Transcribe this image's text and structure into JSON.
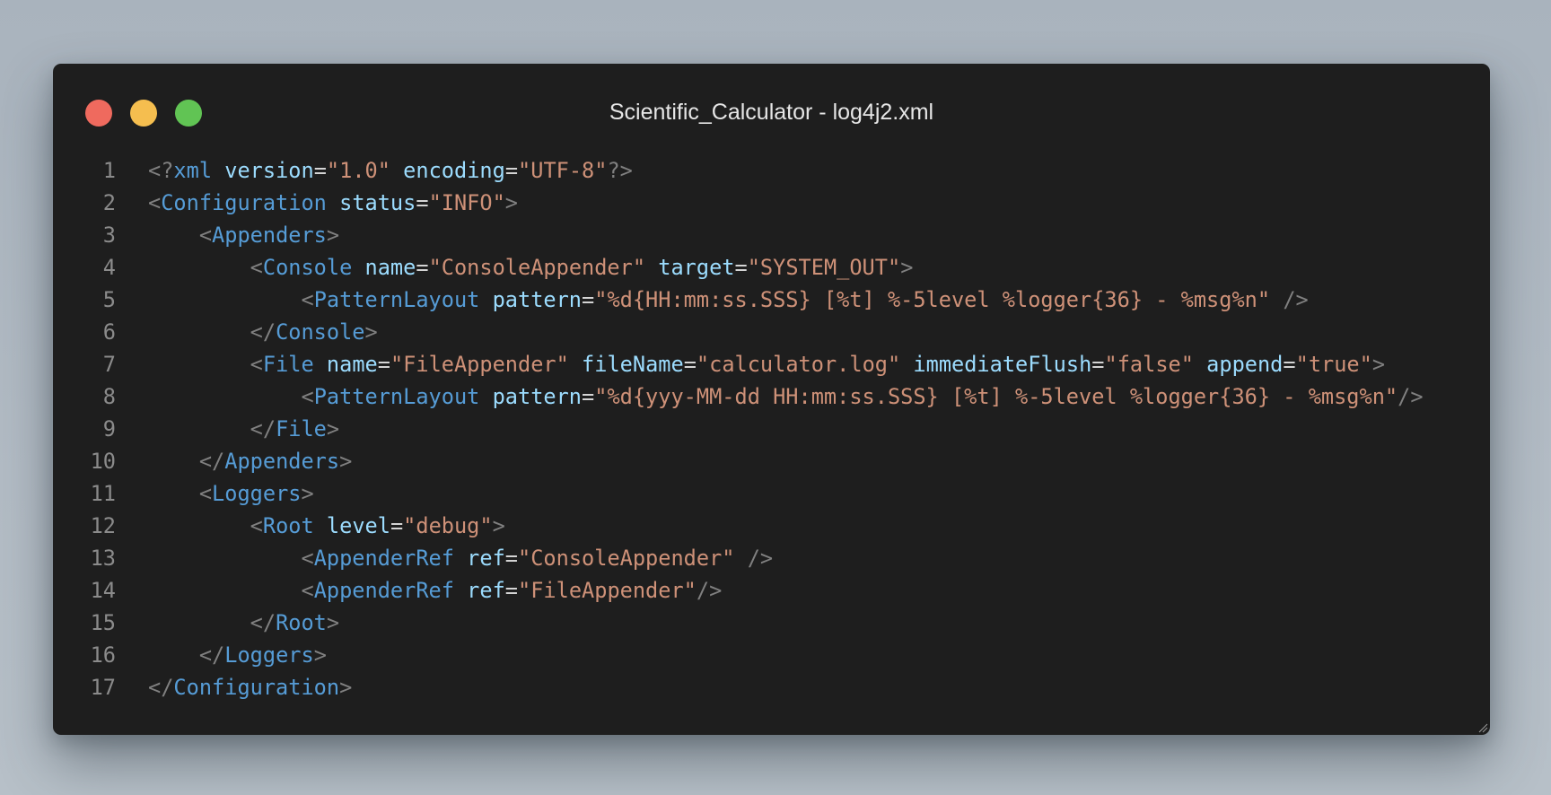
{
  "window": {
    "title": "Scientific_Calculator - log4j2.xml"
  },
  "colors": {
    "background": "#1e1e1e",
    "tag": "#569cd6",
    "attribute": "#9cdcfe",
    "string": "#ce9178",
    "punctuation": "#808080",
    "line_number": "#8b8b8b"
  },
  "editor": {
    "lines": [
      {
        "num": "1",
        "indent": "",
        "tokens": [
          [
            "p",
            "<?"
          ],
          [
            "t",
            "xml"
          ],
          [
            "x",
            " "
          ],
          [
            "a",
            "version"
          ],
          [
            "e",
            "="
          ],
          [
            "s",
            "\"1.0\""
          ],
          [
            "x",
            " "
          ],
          [
            "a",
            "encoding"
          ],
          [
            "e",
            "="
          ],
          [
            "s",
            "\"UTF-8\""
          ],
          [
            "p",
            "?>"
          ]
        ]
      },
      {
        "num": "2",
        "indent": "",
        "tokens": [
          [
            "p",
            "<"
          ],
          [
            "t",
            "Configuration"
          ],
          [
            "x",
            " "
          ],
          [
            "a",
            "status"
          ],
          [
            "e",
            "="
          ],
          [
            "s",
            "\"INFO\""
          ],
          [
            "p",
            ">"
          ]
        ]
      },
      {
        "num": "3",
        "indent": "    ",
        "tokens": [
          [
            "p",
            "<"
          ],
          [
            "t",
            "Appenders"
          ],
          [
            "p",
            ">"
          ]
        ]
      },
      {
        "num": "4",
        "indent": "        ",
        "tokens": [
          [
            "p",
            "<"
          ],
          [
            "t",
            "Console"
          ],
          [
            "x",
            " "
          ],
          [
            "a",
            "name"
          ],
          [
            "e",
            "="
          ],
          [
            "s",
            "\"ConsoleAppender\""
          ],
          [
            "x",
            " "
          ],
          [
            "a",
            "target"
          ],
          [
            "e",
            "="
          ],
          [
            "s",
            "\"SYSTEM_OUT\""
          ],
          [
            "p",
            ">"
          ]
        ]
      },
      {
        "num": "5",
        "indent": "            ",
        "tokens": [
          [
            "p",
            "<"
          ],
          [
            "t",
            "PatternLayout"
          ],
          [
            "x",
            " "
          ],
          [
            "a",
            "pattern"
          ],
          [
            "e",
            "="
          ],
          [
            "s",
            "\"%d{HH:mm:ss.SSS} [%t] %-5level %logger{36} - %msg%n\""
          ],
          [
            "x",
            " "
          ],
          [
            "p",
            "/>"
          ]
        ]
      },
      {
        "num": "6",
        "indent": "        ",
        "tokens": [
          [
            "p",
            "</"
          ],
          [
            "t",
            "Console"
          ],
          [
            "p",
            ">"
          ]
        ]
      },
      {
        "num": "7",
        "indent": "        ",
        "tokens": [
          [
            "p",
            "<"
          ],
          [
            "t",
            "File"
          ],
          [
            "x",
            " "
          ],
          [
            "a",
            "name"
          ],
          [
            "e",
            "="
          ],
          [
            "s",
            "\"FileAppender\""
          ],
          [
            "x",
            " "
          ],
          [
            "a",
            "fileName"
          ],
          [
            "e",
            "="
          ],
          [
            "s",
            "\"calculator.log\""
          ],
          [
            "x",
            " "
          ],
          [
            "a",
            "immediateFlush"
          ],
          [
            "e",
            "="
          ],
          [
            "s",
            "\"false\""
          ],
          [
            "x",
            " "
          ],
          [
            "a",
            "append"
          ],
          [
            "e",
            "="
          ],
          [
            "s",
            "\"true\""
          ],
          [
            "p",
            ">"
          ]
        ]
      },
      {
        "num": "8",
        "indent": "            ",
        "tokens": [
          [
            "p",
            "<"
          ],
          [
            "t",
            "PatternLayout"
          ],
          [
            "x",
            " "
          ],
          [
            "a",
            "pattern"
          ],
          [
            "e",
            "="
          ],
          [
            "s",
            "\"%d{yyy-MM-dd HH:mm:ss.SSS} [%t] %-5level %logger{36} - %msg%n\""
          ],
          [
            "p",
            "/>"
          ]
        ]
      },
      {
        "num": "9",
        "indent": "        ",
        "tokens": [
          [
            "p",
            "</"
          ],
          [
            "t",
            "File"
          ],
          [
            "p",
            ">"
          ]
        ]
      },
      {
        "num": "10",
        "indent": "    ",
        "tokens": [
          [
            "p",
            "</"
          ],
          [
            "t",
            "Appenders"
          ],
          [
            "p",
            ">"
          ]
        ]
      },
      {
        "num": "11",
        "indent": "    ",
        "tokens": [
          [
            "p",
            "<"
          ],
          [
            "t",
            "Loggers"
          ],
          [
            "p",
            ">"
          ]
        ]
      },
      {
        "num": "12",
        "indent": "        ",
        "tokens": [
          [
            "p",
            "<"
          ],
          [
            "t",
            "Root"
          ],
          [
            "x",
            " "
          ],
          [
            "a",
            "level"
          ],
          [
            "e",
            "="
          ],
          [
            "s",
            "\"debug\""
          ],
          [
            "p",
            ">"
          ]
        ]
      },
      {
        "num": "13",
        "indent": "            ",
        "tokens": [
          [
            "p",
            "<"
          ],
          [
            "t",
            "AppenderRef"
          ],
          [
            "x",
            " "
          ],
          [
            "a",
            "ref"
          ],
          [
            "e",
            "="
          ],
          [
            "s",
            "\"ConsoleAppender\""
          ],
          [
            "x",
            " "
          ],
          [
            "p",
            "/>"
          ]
        ]
      },
      {
        "num": "14",
        "indent": "            ",
        "tokens": [
          [
            "p",
            "<"
          ],
          [
            "t",
            "AppenderRef"
          ],
          [
            "x",
            " "
          ],
          [
            "a",
            "ref"
          ],
          [
            "e",
            "="
          ],
          [
            "s",
            "\"FileAppender\""
          ],
          [
            "p",
            "/>"
          ]
        ]
      },
      {
        "num": "15",
        "indent": "        ",
        "tokens": [
          [
            "p",
            "</"
          ],
          [
            "t",
            "Root"
          ],
          [
            "p",
            ">"
          ]
        ]
      },
      {
        "num": "16",
        "indent": "    ",
        "tokens": [
          [
            "p",
            "</"
          ],
          [
            "t",
            "Loggers"
          ],
          [
            "p",
            ">"
          ]
        ]
      },
      {
        "num": "17",
        "indent": "",
        "tokens": [
          [
            "p",
            "</"
          ],
          [
            "t",
            "Configuration"
          ],
          [
            "p",
            ">"
          ]
        ]
      }
    ]
  }
}
